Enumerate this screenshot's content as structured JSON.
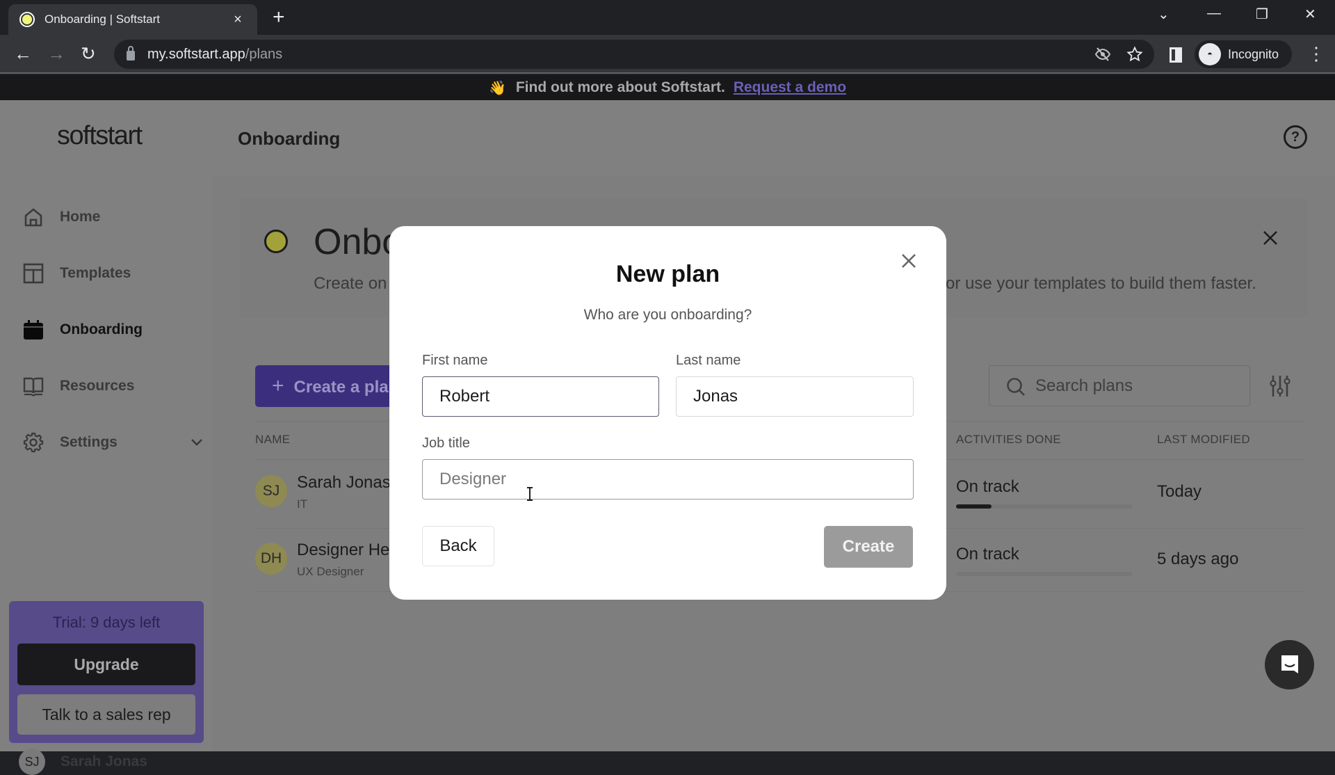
{
  "browser": {
    "tab_title": "Onboarding | Softstart",
    "tab_close": "×",
    "new_tab": "+",
    "url_host": "my.softstart.app",
    "url_path": "/plans",
    "profile_label": "Incognito",
    "window_controls": {
      "tab_search": "⌄",
      "minimize": "—",
      "restore": "❐",
      "close": "✕"
    },
    "nav": {
      "back": "←",
      "forward": "→",
      "reload": "↻"
    },
    "menu": "⋮"
  },
  "banner": {
    "emoji": "👋",
    "text": "Find out more about Softstart.",
    "link": "Request a demo"
  },
  "sidebar": {
    "logo": "softstart",
    "items": [
      {
        "label": "Home",
        "icon": "home-icon",
        "active": false
      },
      {
        "label": "Templates",
        "icon": "templates-icon",
        "active": false
      },
      {
        "label": "Onboarding",
        "icon": "calendar-icon",
        "active": true
      },
      {
        "label": "Resources",
        "icon": "book-icon",
        "active": false
      },
      {
        "label": "Settings",
        "icon": "gear-icon",
        "active": false,
        "expandable": true
      }
    ],
    "trial": {
      "text": "Trial: 9 days left",
      "upgrade": "Upgrade",
      "sales": "Talk to a sales rep"
    },
    "user": {
      "initials": "SJ",
      "name": "Sarah Jonas"
    }
  },
  "header": {
    "title": "Onboarding"
  },
  "intro": {
    "title": "Onboarding",
    "subtitle_left": "Create on",
    "subtitle_right": "or use your templates to build them faster."
  },
  "toolbar": {
    "create_plan": "Create a plan",
    "search_placeholder": "Search plans"
  },
  "table": {
    "headers": {
      "name": "NAME",
      "activities": "ACTIVITIES DONE",
      "modified": "LAST MODIFIED"
    },
    "rows": [
      {
        "initials": "SJ",
        "name": "Sarah Jonas",
        "sub": "IT",
        "status": "On track",
        "progress": 0.2,
        "modified": "Today"
      },
      {
        "initials": "DH",
        "name": "Designer He",
        "sub": "UX Designer",
        "status": "On track",
        "progress": 0.0,
        "modified": "5 days ago"
      }
    ]
  },
  "modal": {
    "title": "New plan",
    "subtitle": "Who are you onboarding?",
    "first_name_label": "First name",
    "first_name_value": "Robert",
    "last_name_label": "Last name",
    "last_name_value": "Jonas",
    "job_title_label": "Job title",
    "job_title_value": "",
    "job_title_placeholder": "Designer",
    "back": "Back",
    "create": "Create"
  },
  "colors": {
    "brand_purple": "#574b8a",
    "create_button_purple": "#3b2f7d",
    "link_purple": "#6b5fb8",
    "status_dot": "#a3a23a",
    "disabled_button": "#9b9b9b"
  }
}
